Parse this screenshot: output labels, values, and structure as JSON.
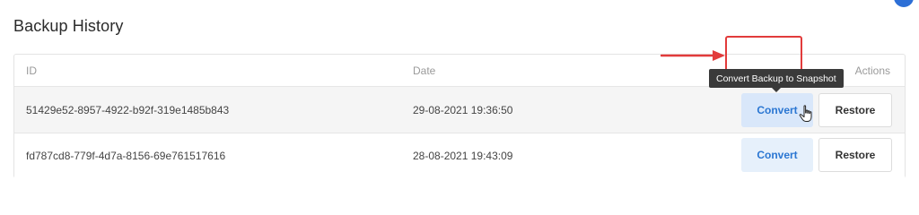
{
  "page": {
    "title": "Backup History"
  },
  "table": {
    "columns": [
      "ID",
      "Date",
      "Actions"
    ],
    "rows": [
      {
        "id": "51429e52-8957-4922-b92f-319e1485b843",
        "date": "29-08-2021 19:36:50",
        "convert_label": "Convert",
        "restore_label": "Restore"
      },
      {
        "id": "fd787cd8-779f-4d7a-8156-69e761517616",
        "date": "28-08-2021 19:43:09",
        "convert_label": "Convert",
        "restore_label": "Restore"
      }
    ]
  },
  "tooltip": {
    "text": "Convert Backup to Snapshot"
  },
  "annotation": {
    "color": "#e23b3b"
  },
  "icons": {
    "cursor": "hand-pointer-icon",
    "arrow": "red-arrow-icon"
  },
  "colors": {
    "accent": "#2a76d2",
    "convert_bg": "#e6f0fb",
    "tooltip_bg": "#3a3a3a"
  }
}
